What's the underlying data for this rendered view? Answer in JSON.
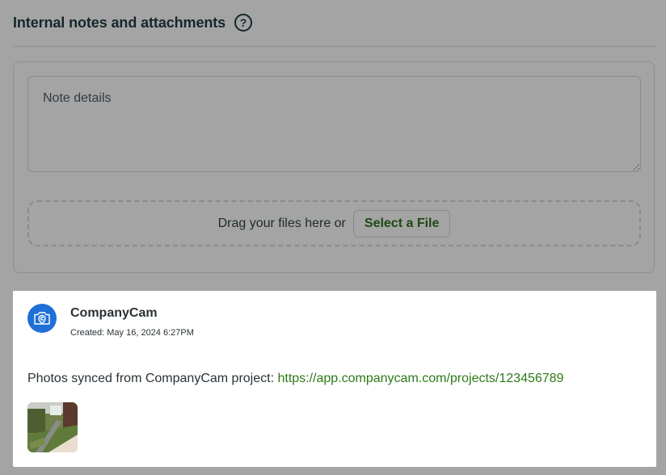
{
  "section": {
    "title": "Internal notes and attachments",
    "help_icon": "?"
  },
  "note_form": {
    "textarea_placeholder": "Note details",
    "textarea_value": "",
    "dropzone_text": "Drag your files here or",
    "select_file_label": "Select a File"
  },
  "feed": {
    "author": "CompanyCam",
    "created_label": "Created:",
    "created_date": "May 16, 2024 6:27PM",
    "message_prefix": "Photos synced from CompanyCam project:",
    "project_link": "https://app.companycam.com/projects/123456789",
    "avatar_icon": "companycam-camera-icon",
    "thumbnail_icon": "photo-thumbnail"
  },
  "colors": {
    "page_overlay": "#a4a4a4",
    "accent_green": "#2d7a18",
    "companycam_blue": "#1f6fd6"
  }
}
